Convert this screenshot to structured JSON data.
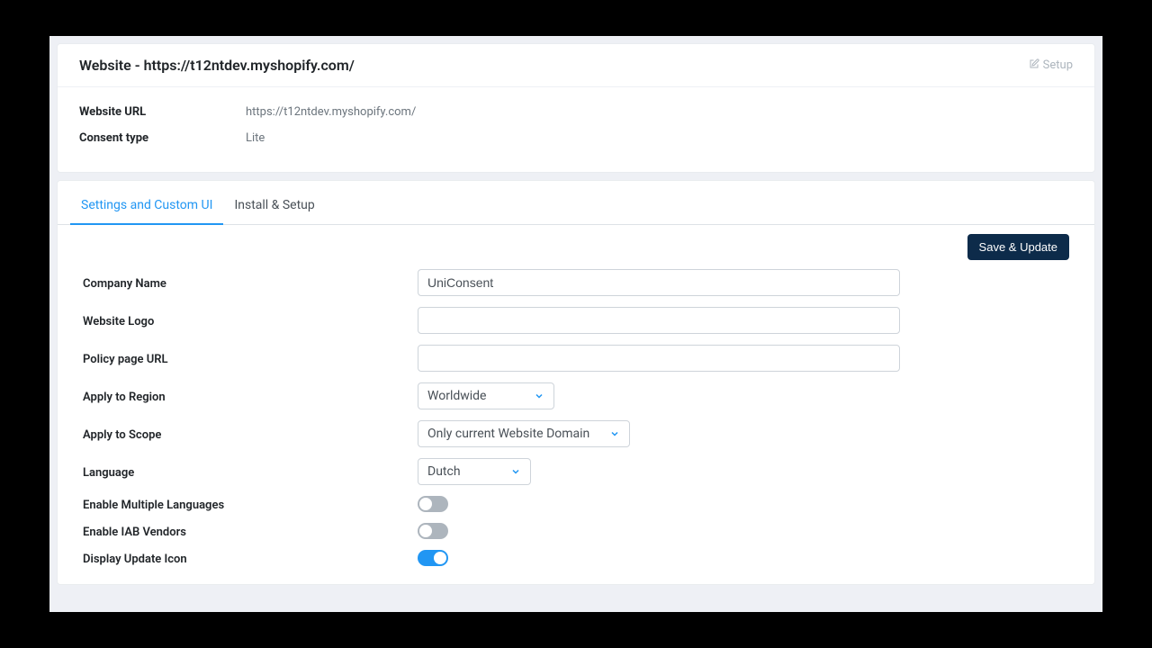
{
  "header": {
    "title": "Website - https://t12ntdev.myshopify.com/",
    "setup_label": "Setup"
  },
  "info": {
    "url_label": "Website URL",
    "url_value": "https://t12ntdev.myshopify.com/",
    "consent_label": "Consent type",
    "consent_value": "Lite"
  },
  "tabs": {
    "settings": "Settings and Custom UI",
    "install": "Install & Setup"
  },
  "actions": {
    "save": "Save & Update"
  },
  "form": {
    "company_label": "Company Name",
    "company_value": "UniConsent",
    "logo_label": "Website Logo",
    "logo_value": "",
    "policy_label": "Policy page URL",
    "policy_value": "",
    "region_label": "Apply to Region",
    "region_value": "Worldwide",
    "scope_label": "Apply to Scope",
    "scope_value": "Only current Website Domain",
    "language_label": "Language",
    "language_value": "Dutch",
    "multi_lang_label": "Enable Multiple Languages",
    "multi_lang_on": false,
    "iab_label": "Enable IAB Vendors",
    "iab_on": false,
    "update_icon_label": "Display Update Icon",
    "update_icon_on": true
  }
}
